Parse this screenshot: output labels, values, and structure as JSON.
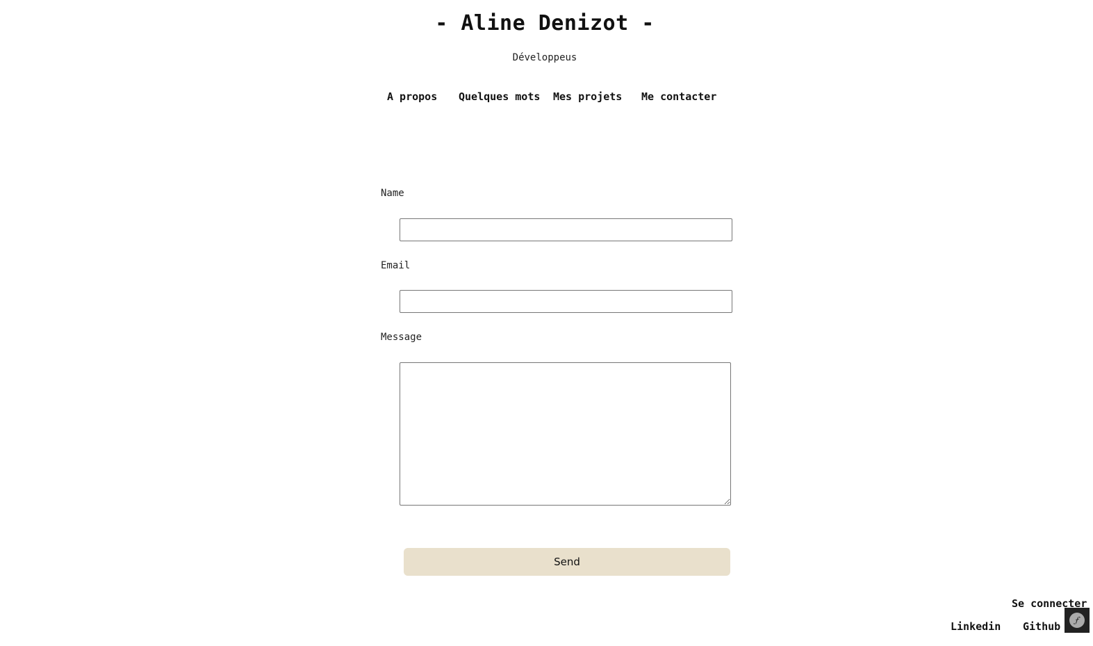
{
  "header": {
    "title": "- Aline Denizot -",
    "subtitle": "Développeus"
  },
  "nav": {
    "items": [
      {
        "label": "A propos"
      },
      {
        "label": "Quelques mots"
      },
      {
        "label": "Mes projets"
      },
      {
        "label": "Me contacter"
      }
    ]
  },
  "contact_form": {
    "name_label": "Name",
    "name_value": "",
    "email_label": "Email",
    "email_value": "",
    "message_label": "Message",
    "message_value": "",
    "submit_label": "Send"
  },
  "footer": {
    "login_label": "Se connecter",
    "links": [
      {
        "label": "Linkedin"
      },
      {
        "label": "Github"
      }
    ]
  },
  "colors": {
    "background": "#ffffff",
    "text": "#111111",
    "button_bg": "#e9e0cc",
    "toolbar_bg": "#222222"
  },
  "icons": {
    "toolbar_toggle": "symfony-logo-icon"
  }
}
